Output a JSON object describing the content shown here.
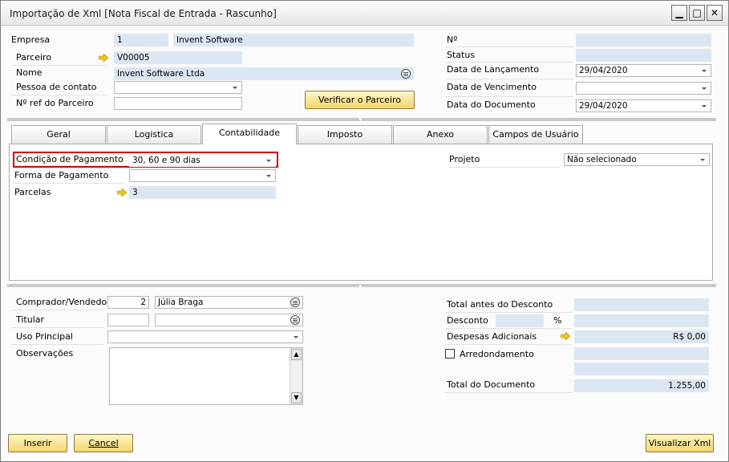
{
  "window": {
    "title": "Importação de Xml [Nota Fiscal de Entrada - Rascunho]",
    "controls": {
      "minimize": "▁",
      "maximize": "□",
      "close": "✕"
    }
  },
  "header": {
    "empresa": {
      "label": "Empresa",
      "code": "1",
      "name": "Invent Software"
    },
    "parceiro": {
      "label": "Parceiro",
      "value": "V00005"
    },
    "nome": {
      "label": "Nome",
      "value": "Invent Software Ltda"
    },
    "pessoa_contato": {
      "label": "Pessoa de contato",
      "value": ""
    },
    "nref_parceiro": {
      "label": "Nº ref do Parceiro",
      "value": ""
    },
    "verificar_button": "Verificar o Parceiro",
    "numero": {
      "label": "Nº",
      "value": ""
    },
    "status": {
      "label": "Status",
      "value": ""
    },
    "data_lancamento": {
      "label": "Data de Lançamento",
      "value": "29/04/2020"
    },
    "data_vencimento": {
      "label": "Data de Vencimento",
      "value": ""
    },
    "data_documento": {
      "label": "Data do Documento",
      "value": "29/04/2020"
    }
  },
  "tabs": [
    "Geral",
    "Logistica",
    "Contabilidade",
    "Imposto",
    "Anexo",
    "Campos de Usuário"
  ],
  "active_tab": "Contabilidade",
  "contabilidade": {
    "condicao_pagamento": {
      "label": "Condição de Pagamento",
      "value": "30, 60 e 90 dias"
    },
    "forma_pagamento": {
      "label": "Forma de Pagamento",
      "value": ""
    },
    "parcelas": {
      "label": "Parcelas",
      "value": "3"
    },
    "projeto": {
      "label": "Projeto",
      "value": "Não selecionado"
    }
  },
  "footer": {
    "comprador": {
      "label": "Comprador/Vendedor",
      "code": "2",
      "name": "Júlia Braga"
    },
    "titular": {
      "label": "Titular",
      "code": "",
      "name": ""
    },
    "uso_principal": {
      "label": "Uso Principal",
      "value": ""
    },
    "observacoes": {
      "label": "Observações",
      "value": ""
    },
    "total_antes_desconto": {
      "label": "Total antes do Desconto",
      "value": ""
    },
    "desconto": {
      "label": "Desconto",
      "value": "",
      "pct_symbol": "%",
      "amount": ""
    },
    "despesas_adicionais": {
      "label": "Despesas Adicionais",
      "value": "R$ 0,00"
    },
    "arredondamento": {
      "label": "Arredondamento",
      "checked": false,
      "value": ""
    },
    "total_documento": {
      "label": "Total do Documento",
      "value": "1.255,00"
    }
  },
  "buttons": {
    "inserir": "Inserir",
    "cancel": "Cancel",
    "visualizar": "Visualizar Xml"
  },
  "colors": {
    "readonly": "#dce6f2",
    "button": "#f3d66b",
    "highlight_border": "#d40000",
    "link_arrow": "#f0c419"
  }
}
